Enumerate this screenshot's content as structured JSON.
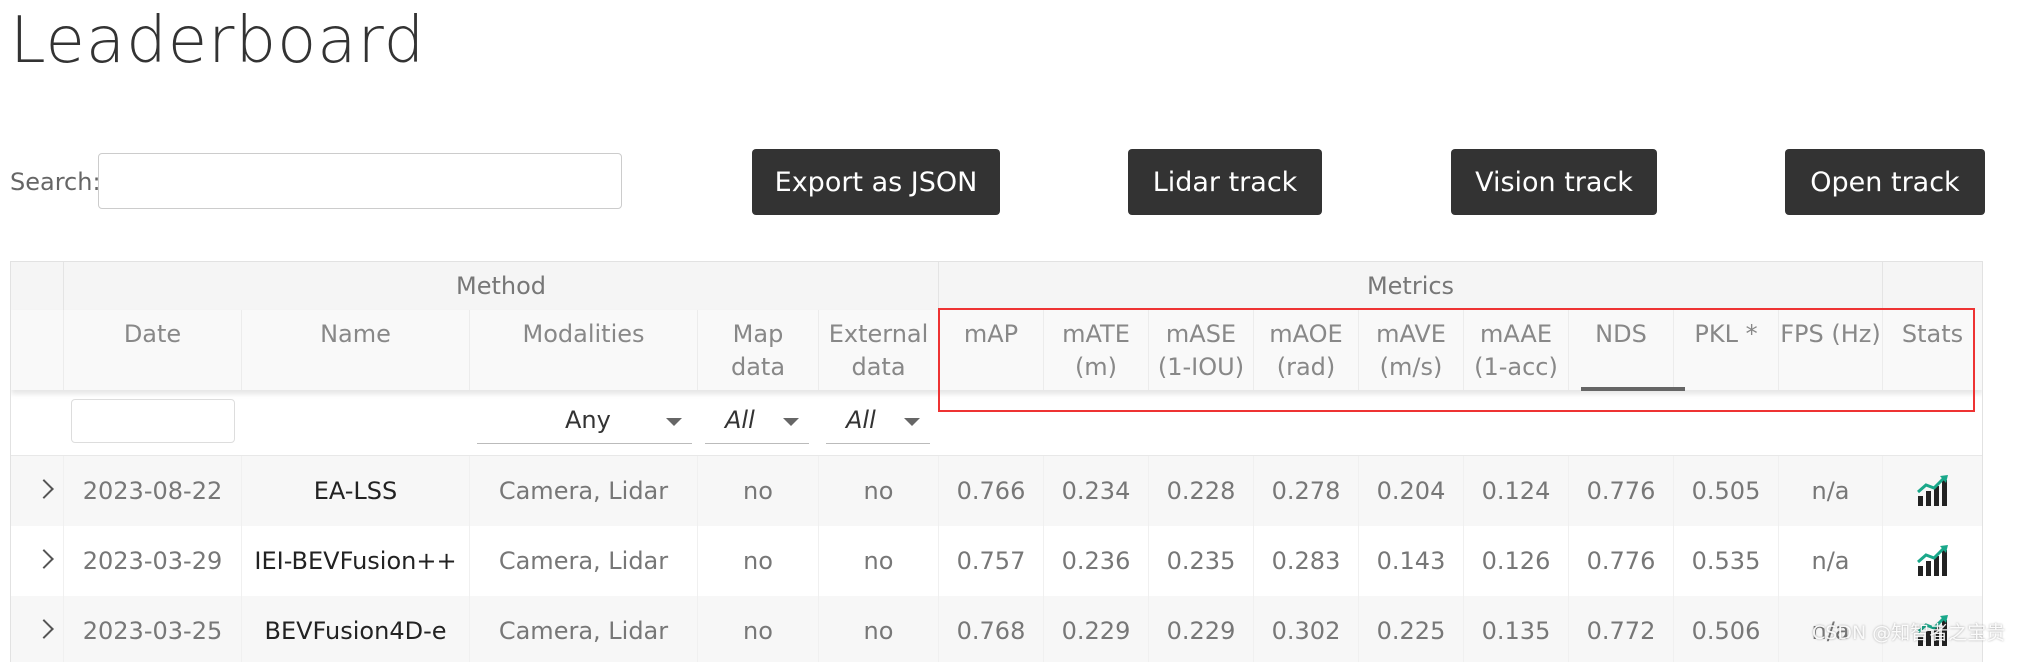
{
  "page": {
    "title": "Leaderboard",
    "search_label": "Search:",
    "search_value": "",
    "watermark": "CSDN @知智者之宝贵"
  },
  "toolbar": {
    "export_label": "Export as JSON",
    "lidar_label": "Lidar track",
    "vision_label": "Vision track",
    "open_label": "Open track"
  },
  "table": {
    "groups": {
      "method": "Method",
      "metrics": "Metrics"
    },
    "columns": {
      "date": "Date",
      "name": "Name",
      "modalities": "Modalities",
      "map": "Map\ndata",
      "external": "External\ndata",
      "map_": "mAP",
      "mate": "mATE\n(m)",
      "mase": "mASE\n(1-IOU)",
      "maoe": "mAOE\n(rad)",
      "mave": "mAVE\n(m/s)",
      "maae": "mAAE\n(1-acc)",
      "nds": "NDS",
      "pkl": "PKL *",
      "fps": "FPS (Hz)",
      "stats": "Stats"
    },
    "filters": {
      "modalities": "Any",
      "map": "All",
      "external": "All"
    },
    "rows": [
      {
        "date": "2023-08-22",
        "name": "EA-LSS",
        "modalities": "Camera, Lidar",
        "map": "no",
        "external": "no",
        "map_": "0.766",
        "mate": "0.234",
        "mase": "0.228",
        "maoe": "0.278",
        "mave": "0.204",
        "maae": "0.124",
        "nds": "0.776",
        "pkl": "0.505",
        "fps": "n/a"
      },
      {
        "date": "2023-03-29",
        "name": "IEI-BEVFusion++",
        "modalities": "Camera, Lidar",
        "map": "no",
        "external": "no",
        "map_": "0.757",
        "mate": "0.236",
        "mase": "0.235",
        "maoe": "0.283",
        "mave": "0.143",
        "maae": "0.126",
        "nds": "0.776",
        "pkl": "0.535",
        "fps": "n/a"
      },
      {
        "date": "2023-03-25",
        "name": "BEVFusion4D-e",
        "modalities": "Camera, Lidar",
        "map": "no",
        "external": "no",
        "map_": "0.768",
        "mate": "0.229",
        "mase": "0.229",
        "maoe": "0.302",
        "mave": "0.225",
        "maae": "0.135",
        "nds": "0.772",
        "pkl": "0.506",
        "fps": "n/a"
      }
    ]
  },
  "colors": {
    "button_bg": "#333333",
    "highlight_box": "#ee3333",
    "stats_icon": "#222222",
    "stats_icon_accent": "#1aa88a"
  }
}
